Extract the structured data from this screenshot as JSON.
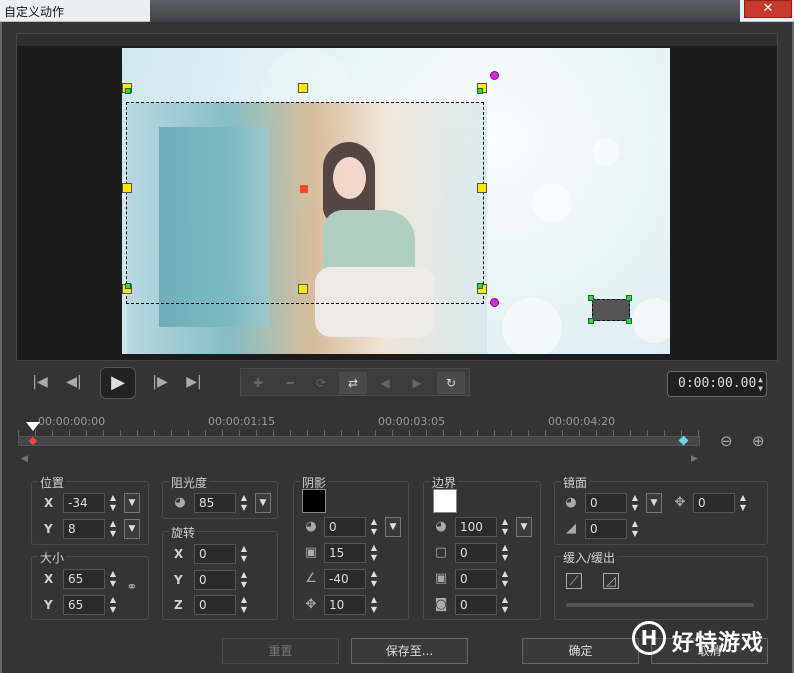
{
  "window": {
    "title": "自定义动作",
    "close_label": "✕"
  },
  "transport": {
    "buttons": [
      "|◀",
      "◀|",
      "▶",
      "|▶",
      "▶|"
    ],
    "keyframe_buttons": [
      "✚",
      "━",
      "⟳",
      "⇄",
      "◀",
      "▶",
      "↻"
    ],
    "timecode": "0:00:00.00"
  },
  "timeline": {
    "labels": [
      "00:00:00:00",
      "00:00:01:15",
      "00:00:03:05",
      "00:00:04:20"
    ]
  },
  "position": {
    "label": "位置",
    "x_axis": "X",
    "y_axis": "Y",
    "x": "-34",
    "y": "8"
  },
  "size": {
    "label": "大小",
    "x_axis": "X",
    "y_axis": "Y",
    "x": "65",
    "y": "65"
  },
  "opacity": {
    "label": "阻光度",
    "value": "85"
  },
  "rotation": {
    "label": "旋转",
    "x_axis": "X",
    "y_axis": "Y",
    "z_axis": "Z",
    "x": "0",
    "y": "0",
    "z": "0"
  },
  "shadow": {
    "label": "阴影",
    "color": "#000000",
    "opacity": "0",
    "blur": "15",
    "angle": "-40",
    "distance": "10"
  },
  "border": {
    "label": "边界",
    "color": "#ffffff",
    "opacity": "100",
    "width": "0",
    "transparency": "0",
    "blur": "0"
  },
  "mirror": {
    "label": "镜面",
    "opacity": "0",
    "distance": "0",
    "gap": "0"
  },
  "ease": {
    "label": "缓入/缓出"
  },
  "footer": {
    "reset": "重置",
    "save_to": "保存至...",
    "ok": "确定",
    "cancel": "取消"
  },
  "watermark": {
    "logo": "H",
    "text": "好特游戏"
  },
  "icons": {
    "spin": "spin-arrows-icon",
    "dropdown": "dropdown-icon",
    "link": "link-icon",
    "move": "move-icon"
  }
}
